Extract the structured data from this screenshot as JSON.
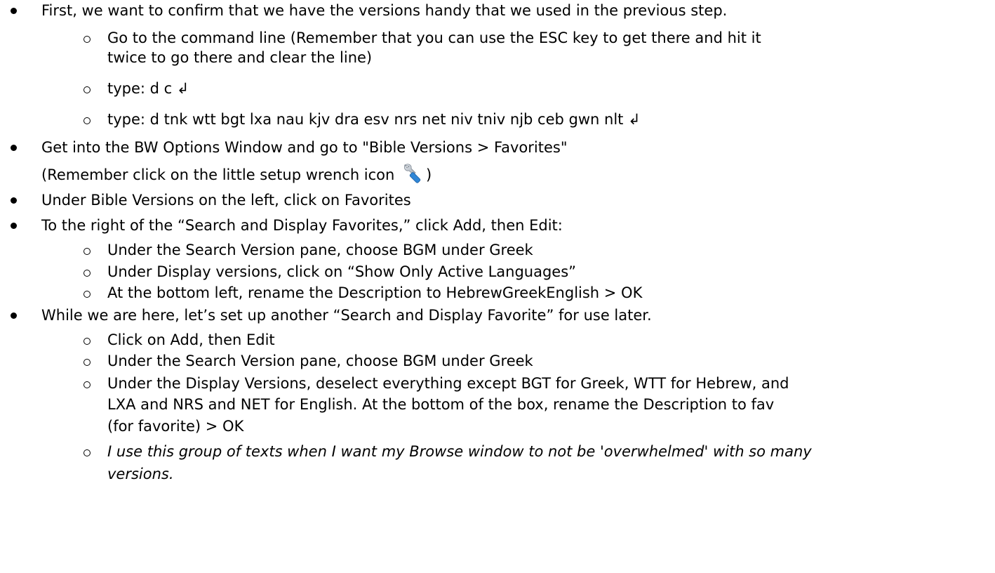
{
  "lines": {
    "l1": "First, we want to confirm that we have the versions handy that we used in the previous step.",
    "l2": "Go to the command line (Remember that you can use the ESC key to get there and hit it",
    "l2b": "twice to go there and clear the line)",
    "l3": "type: d c ↲",
    "l4": "type: d tnk wtt bgt lxa nau kjv dra esv nrs net niv tniv njb ceb gwn nlt ↲",
    "l5": "Get into the BW Options Window and go to \"Bible Versions > Favorites\"",
    "l5b_pre": "(Remember click on the little setup wrench icon",
    "l5b_post": ")",
    "l6": "Under Bible Versions on the left, click on Favorites",
    "l7": "To the right of the “Search and Display Favorites,” click Add, then Edit:",
    "l8": "Under the Search Version pane, choose BGM under Greek",
    "l9": "Under Display versions, click on “Show Only Active Languages”",
    "l10": "At the bottom left, rename the Description to HebrewGreekEnglish > OK",
    "l11": "While we are here, let’s set up another “Search and Display Favorite” for use later.",
    "l12": "Click on Add, then Edit",
    "l13": "Under the Search Version pane, choose BGM under Greek",
    "l14": "Under the Display Versions, deselect everything except BGT for Greek, WTT for Hebrew, and",
    "l14b": "LXA and NRS and NET for English. At the bottom of the box, rename the Description to fav",
    "l14c": "(for favorite) > OK",
    "l15": "I use this group of texts when I want my Browse window to not be 'overwhelmed' with so many",
    "l15b": "versions."
  },
  "icons": {
    "wrench": "wrench-icon"
  }
}
